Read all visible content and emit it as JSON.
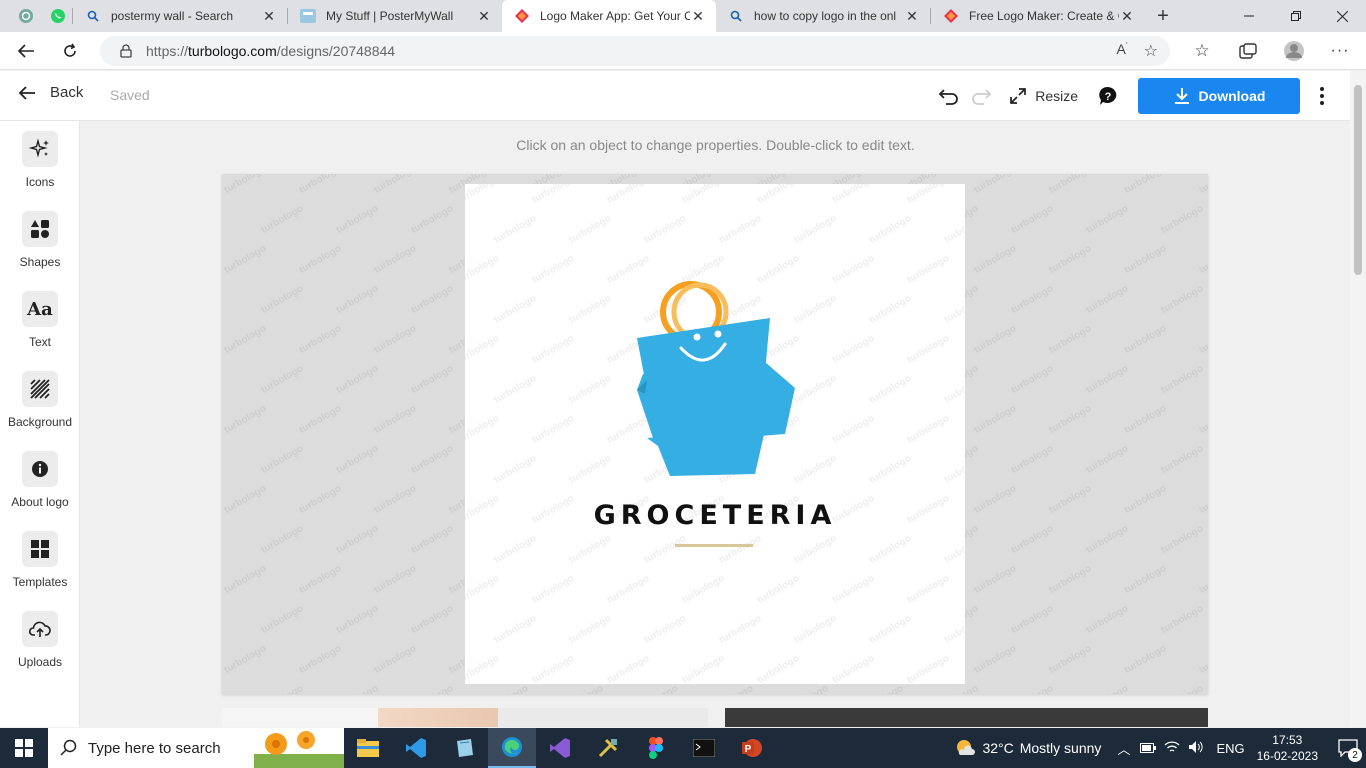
{
  "browser": {
    "tabs": [
      {
        "title": "postermy wall - Search",
        "active": false
      },
      {
        "title": "My Stuff | PosterMyWall",
        "active": false
      },
      {
        "title": "Logo Maker App: Get Your C",
        "active": true
      },
      {
        "title": "how to copy logo in the onl",
        "active": false
      },
      {
        "title": "Free Logo Maker: Create & C",
        "active": false
      }
    ],
    "url_prefix": "https://",
    "url_host": "turbologo.com",
    "url_path": "/designs/20748844"
  },
  "app": {
    "back_label": "Back",
    "saved_label": "Saved",
    "resize_label": "Resize",
    "download_label": "Download",
    "accent": "#1a86ef"
  },
  "sidebar": {
    "items": [
      {
        "label": "Icons",
        "icon": "sparkle-icon"
      },
      {
        "label": "Shapes",
        "icon": "shapes-icon"
      },
      {
        "label": "Text",
        "icon": "text-aa-icon"
      },
      {
        "label": "Background",
        "icon": "stripes-icon"
      },
      {
        "label": "About logo",
        "icon": "info-icon"
      },
      {
        "label": "Templates",
        "icon": "grid-icon"
      },
      {
        "label": "Uploads",
        "icon": "cloud-upload-icon"
      }
    ]
  },
  "canvas": {
    "hint": "Click on an object to change properties. Double-click to edit text.",
    "watermark": "turbologo",
    "logo_text": "GROCETERIA",
    "logo_colors": {
      "bag": "#34aee3",
      "handle": "#f5a020",
      "underline": "#d8c79a",
      "text": "#111111"
    }
  },
  "taskbar": {
    "search_placeholder": "Type here to search",
    "weather_temp": "32°C",
    "weather_text": "Mostly sunny",
    "language": "ENG",
    "time": "17:53",
    "date": "16-02-2023",
    "notification_count": "2"
  }
}
